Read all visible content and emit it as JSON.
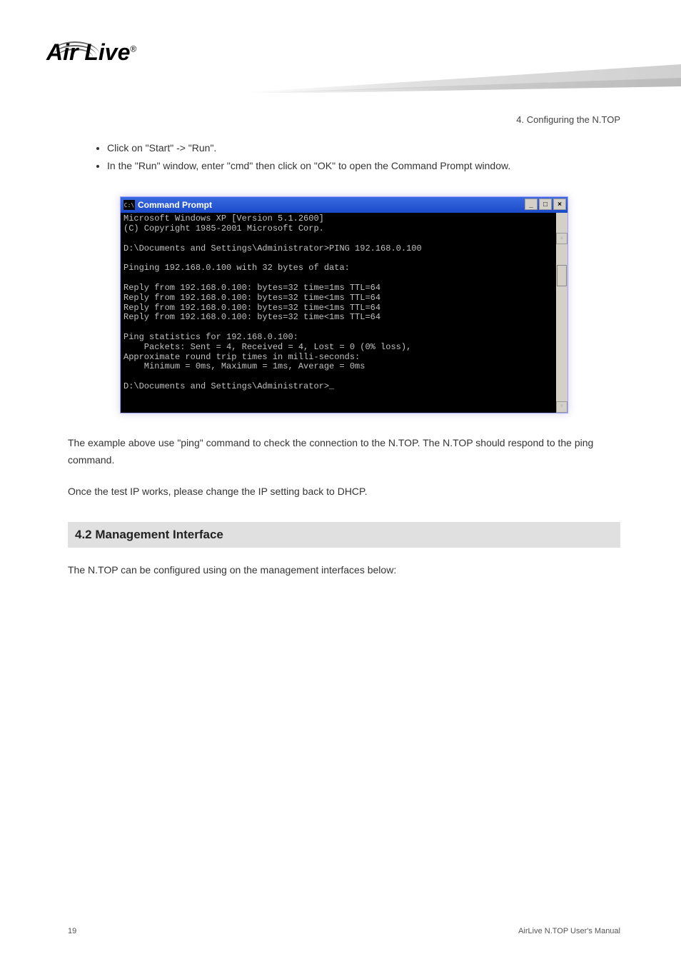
{
  "header": {
    "logo_text": "Air Live",
    "logo_reg": "®",
    "chapter_label": "4. Configuring the N.TOP"
  },
  "bullets": [
    "Click on \"Start\" -> \"Run\".",
    "In the \"Run\" window, enter \"cmd\" then click on \"OK\" to open the Command Prompt window."
  ],
  "cmd": {
    "title": "Command Prompt",
    "icon_text": "C:\\",
    "min_btn": "_",
    "max_btn": "□",
    "close_btn": "×",
    "scroll_up": "▲",
    "scroll_down": "▼",
    "lines": [
      "Microsoft Windows XP [Version 5.1.2600]",
      "(C) Copyright 1985-2001 Microsoft Corp.",
      "",
      "D:\\Documents and Settings\\Administrator>PING 192.168.0.100",
      "",
      "Pinging 192.168.0.100 with 32 bytes of data:",
      "",
      "Reply from 192.168.0.100: bytes=32 time=1ms TTL=64",
      "Reply from 192.168.0.100: bytes=32 time<1ms TTL=64",
      "Reply from 192.168.0.100: bytes=32 time<1ms TTL=64",
      "Reply from 192.168.0.100: bytes=32 time<1ms TTL=64",
      "",
      "Ping statistics for 192.168.0.100:",
      "    Packets: Sent = 4, Received = 4, Lost = 0 (0% loss),",
      "Approximate round trip times in milli-seconds:",
      "    Minimum = 0ms, Maximum = 1ms, Average = 0ms",
      "",
      "D:\\Documents and Settings\\Administrator>_"
    ]
  },
  "paragraphs": {
    "p1": "The example above use \"ping\" command to check the connection to the N.TOP. The N.TOP should respond to the ping command.",
    "p2": "Once the test IP works, please change the IP setting back to DHCP."
  },
  "section": {
    "heading": "4.2 Management Interface",
    "body": "The N.TOP can be configured using on the management interfaces below:"
  },
  "footer": {
    "page": "19",
    "product": "AirLive N.TOP User's Manual"
  }
}
